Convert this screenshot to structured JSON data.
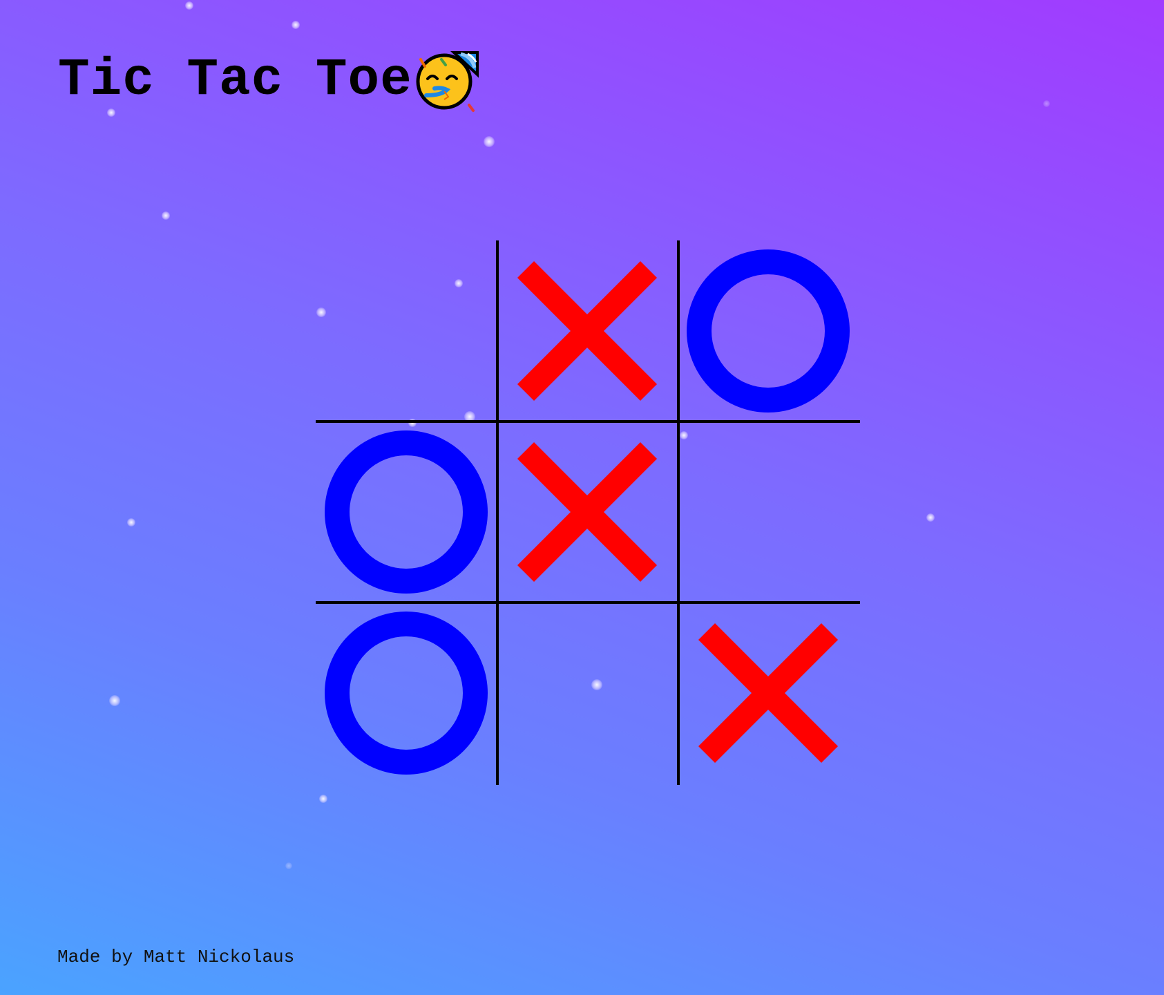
{
  "title": "Tic Tac Toe",
  "title_icon": "partying-face-icon",
  "board": {
    "cells": [
      "",
      "X",
      "O",
      "O",
      "X",
      "",
      "O",
      "",
      "X"
    ]
  },
  "marks": {
    "x_color": "#ff0000",
    "o_color": "#0000ff"
  },
  "footer": {
    "credit": "Made by Matt Nickolaus"
  },
  "colors": {
    "background_top": "#a13bff",
    "background_bottom": "#4aa3ff",
    "grid": "#000000"
  }
}
